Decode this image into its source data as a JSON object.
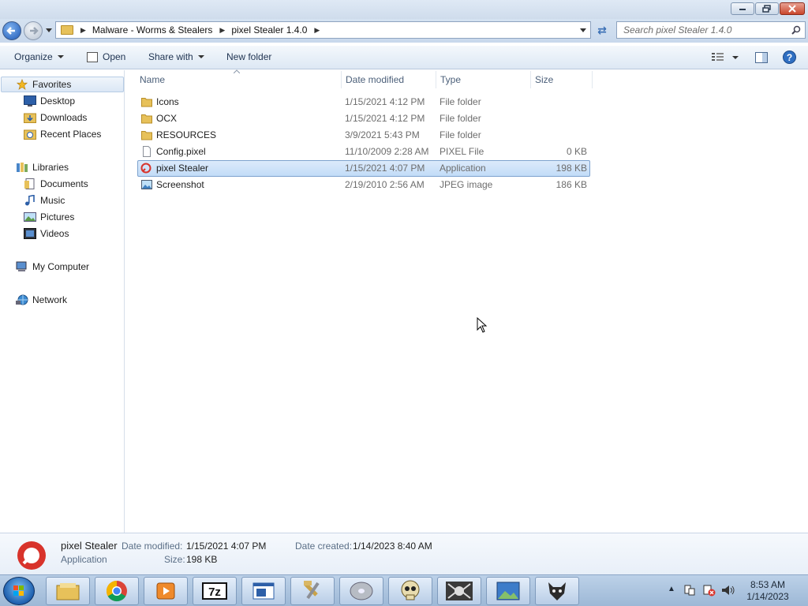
{
  "window": {
    "controls": {
      "minimize": "minimize",
      "maximize": "maximize",
      "close": "close"
    }
  },
  "address": {
    "breadcrumbs": [
      "Malware - Worms & Stealers",
      "pixel Stealer 1.4.0"
    ],
    "search_placeholder": "Search pixel Stealer 1.4.0"
  },
  "toolbar": {
    "organize": "Organize",
    "open": "Open",
    "share_with": "Share with",
    "new_folder": "New folder"
  },
  "nav": {
    "favorites": {
      "label": "Favorites",
      "items": [
        "Desktop",
        "Downloads",
        "Recent Places"
      ]
    },
    "libraries": {
      "label": "Libraries",
      "items": [
        "Documents",
        "Music",
        "Pictures",
        "Videos"
      ]
    },
    "computer": "My Computer",
    "network": "Network"
  },
  "columns": {
    "name": "Name",
    "date": "Date modified",
    "type": "Type",
    "size": "Size"
  },
  "files": [
    {
      "name": "Icons",
      "date": "1/15/2021 4:12 PM",
      "type": "File folder",
      "size": "",
      "icon": "folder-icon"
    },
    {
      "name": "OCX",
      "date": "1/15/2021 4:12 PM",
      "type": "File folder",
      "size": "",
      "icon": "folder-icon"
    },
    {
      "name": "RESOURCES",
      "date": "3/9/2021 5:43 PM",
      "type": "File folder",
      "size": "",
      "icon": "folder-icon"
    },
    {
      "name": "Config.pixel",
      "date": "11/10/2009 2:28 AM",
      "type": "PIXEL File",
      "size": "0 KB",
      "icon": "document-icon"
    },
    {
      "name": "pixel Stealer",
      "date": "1/15/2021 4:07 PM",
      "type": "Application",
      "size": "198 KB",
      "icon": "app-icon",
      "selected": true
    },
    {
      "name": "Screenshot",
      "date": "2/19/2010 2:56 AM",
      "type": "JPEG image",
      "size": "186 KB",
      "icon": "image-icon"
    }
  ],
  "details": {
    "name": "pixel Stealer",
    "type": "Application",
    "date_modified_label": "Date modified:",
    "date_modified": "1/15/2021 4:07 PM",
    "size_label": "Size:",
    "size": "198 KB",
    "date_created_label": "Date created:",
    "date_created": "1/14/2023 8:40 AM"
  },
  "taskbar": {
    "apps": [
      "file-explorer-icon",
      "chrome-icon",
      "media-player-icon",
      "7zip-icon",
      "window-app-icon",
      "tools-icon",
      "disc-icon",
      "skull-icon",
      "spider-icon",
      "image-viewer-icon",
      "wolf-icon"
    ],
    "time": "8:53 AM",
    "date": "1/14/2023"
  },
  "colors": {
    "accent": "#3a6fb5",
    "selection": "#c2dcf7",
    "taskbar": "#9db8d6"
  }
}
